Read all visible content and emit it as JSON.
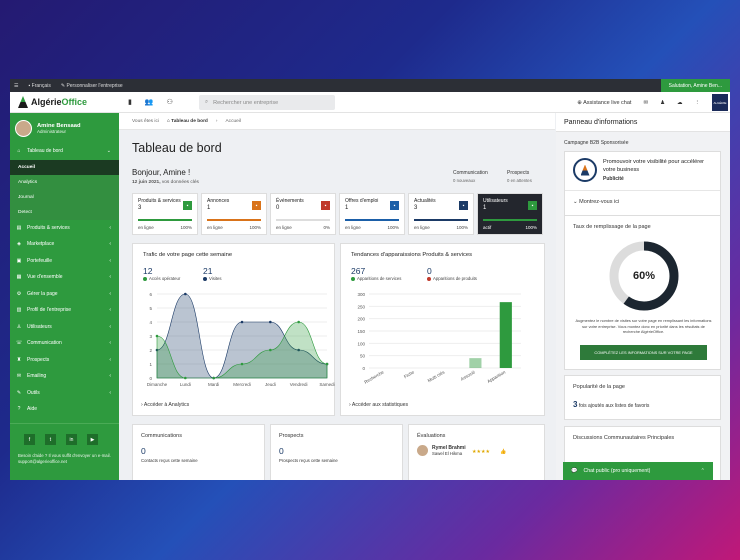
{
  "topbar": {
    "lang": "Français",
    "personalize": "Personnaliser l'entreprise",
    "greeting": "Salutation, Amine Ben..."
  },
  "header": {
    "logo_main": "Algérie",
    "logo_accent": "Office",
    "search_placeholder": "Rechercher une entreprise",
    "assist": "Assistance live chat",
    "flag_text": "ALGÉRIE"
  },
  "sidebar": {
    "user_name": "Amine Bensaad",
    "user_role": "Administrateur",
    "dashboard": "Tableau de bord",
    "subs": [
      "Accueil",
      "Analytics",
      "Journal",
      "Detect"
    ],
    "items": [
      "Produits & services",
      "Marketplace",
      "Portefeuille",
      "Vue d'ensemble",
      "Gérer la page",
      "Profil de l'entreprise",
      "Utilisateurs",
      "Communication",
      "Prospects",
      "Emailing",
      "Outils",
      "Aide"
    ],
    "help": "Besoin d'aide ? Il vous suffit d'envoyer un e-mail.",
    "email": "support@algerieoffice.net"
  },
  "breadcrumb": {
    "here": "Vous êtes ici",
    "home": "Tableau de bord",
    "current": "Accueil"
  },
  "page": {
    "title": "Tableau de bord",
    "hello": "Bonjour, Amine !",
    "date_strong": "12 juin 2021,",
    "date_rest": " vos données clés"
  },
  "stats": [
    {
      "label": "Communication",
      "sub": "0 nouveaux"
    },
    {
      "label": "Prospects",
      "sub": "0 en attentes"
    }
  ],
  "kpis": [
    {
      "title": "Produits & services",
      "value": "3",
      "left": "en ligne",
      "right": "100%",
      "color": "#2e9a3e",
      "pct": 100
    },
    {
      "title": "Annonces",
      "value": "1",
      "left": "en ligne",
      "right": "100%",
      "color": "#d9731a",
      "pct": 100
    },
    {
      "title": "Événements",
      "value": "0",
      "left": "en ligne",
      "right": "0%",
      "color": "#c0392b",
      "pct": 0
    },
    {
      "title": "Offres d'emploi",
      "value": "1",
      "left": "en ligne",
      "right": "100%",
      "color": "#1b5fa8",
      "pct": 100
    },
    {
      "title": "Actualités",
      "value": "3",
      "left": "en ligne",
      "right": "100%",
      "color": "#1b3a66",
      "pct": 100
    },
    {
      "title": "Utilisateurs",
      "value": "1",
      "left": "actif",
      "right": "100%",
      "color": "#2e9a3e",
      "pct": 100
    }
  ],
  "traffic": {
    "title": "Trafic de votre page cette semaine",
    "v1": "12",
    "l1": "Accès opérateur",
    "v2": "21",
    "l2": "Visites",
    "footer": "Accéder à Analytics"
  },
  "trends": {
    "title": "Tendances d'apparaissions Produits & services",
    "v1": "267",
    "l1": "Apparitions de services",
    "v2": "0",
    "l2": "Apparitions de produits",
    "footer": "Accéder aux statistiques"
  },
  "chart_data": [
    {
      "type": "line",
      "title": "Trafic de votre page cette semaine",
      "categories": [
        "Dimanche",
        "Lundi",
        "Mardi",
        "Mercredi",
        "Jeudi",
        "Vendredi",
        "Samedi"
      ],
      "ylim": [
        0,
        6
      ],
      "yticks": [
        0,
        1,
        2,
        3,
        4,
        5,
        6
      ],
      "series": [
        {
          "name": "Accès opérateur",
          "color": "#2e9a3e",
          "values": [
            3,
            0,
            0,
            1,
            2,
            4,
            1
          ]
        },
        {
          "name": "Visites",
          "color": "#1b3a66",
          "values": [
            2,
            6,
            0,
            4,
            4,
            2,
            1
          ]
        }
      ]
    },
    {
      "type": "bar",
      "title": "Tendances d'apparaissions Produits & services",
      "categories": [
        "Recherche",
        "Fiche",
        "Multi clés",
        "Associé",
        "Apparition"
      ],
      "ylim": [
        0,
        300
      ],
      "yticks": [
        0,
        50,
        100,
        150,
        200,
        250,
        300
      ],
      "series": [
        {
          "name": "Apparitions de services",
          "color": "#2e9a3e",
          "values": [
            0,
            0,
            0,
            40,
            267
          ]
        }
      ]
    }
  ],
  "bottom": {
    "comm_title": "Communications",
    "comm_val": "0",
    "comm_sub": "Contacts reçus cette semaine",
    "pro_title": "Prospects",
    "pro_val": "0",
    "pro_sub": "Prospects reçus cette semaine",
    "eval_title": "Évaluations",
    "eval_name": "Rymel Brahmi",
    "eval_sub": "Sawel El Hikma"
  },
  "rightpanel": {
    "title": "Panneau d'informations",
    "camp": "Campagne B2B Sponsorisée",
    "promo": "Promouvoir votre visibilité pour accélérer votre business",
    "promo_tag": "Publicité",
    "more": "Montrez-vous ici",
    "fill_title": "Taux de remplissage de la page",
    "fill_pct": 60,
    "fill_label": "60%",
    "fill_desc": "Augmentez le nombre de visites sur votre page en remplissant les informations sur votre entreprise. Vous montez donc en priorité dans les résultats de recherche AlgérieOffice.",
    "fill_btn": "COMPLÉTEZ LES INFORMATIONS SUR VOTRE PAGE",
    "pop_title": "Popularité de la page",
    "pop_val": "3",
    "pop_text": "fois ajoutés aux listes de favoris",
    "disc_title": "Discussions Communautaires Principales",
    "chat": "Chat public (pro uniquement)"
  }
}
